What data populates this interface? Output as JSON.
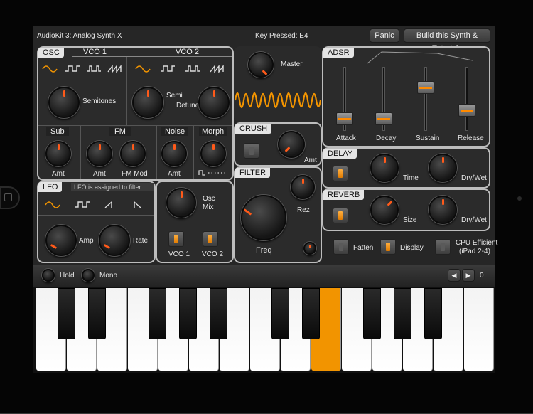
{
  "header": {
    "app_title": "AudioKit 3: Analog Synth X",
    "key_pressed": "Key Pressed: E4",
    "panic_label": "Panic",
    "build_label": "Build this Synth & Tutorials"
  },
  "osc": {
    "tab": "OSC",
    "vco1_title": "VCO 1",
    "vco2_title": "VCO 2",
    "semitones_label": "Semitones",
    "semi_label": "Semi",
    "detune_label": "Detune",
    "sub_title": "Sub",
    "fm_title": "FM",
    "noise_title": "Noise",
    "morph_title": "Morph",
    "sub_amt": "Amt",
    "fm_amt": "Amt",
    "fm_mod": "FM Mod",
    "noise_amt": "Amt"
  },
  "master": {
    "label": "Master"
  },
  "crush": {
    "tab": "CRUSH",
    "amt_label": "Amt"
  },
  "filter": {
    "tab": "FILTER",
    "freq_label": "Freq",
    "rez_label": "Rez"
  },
  "adsr": {
    "tab": "ADSR",
    "attack": "Attack",
    "decay": "Decay",
    "sustain": "Sustain",
    "release": "Release"
  },
  "delay": {
    "tab": "DELAY",
    "time_label": "Time",
    "drywet_label": "Dry/Wet"
  },
  "reverb": {
    "tab": "REVERB",
    "size_label": "Size",
    "drywet_label": "Dry/Wet"
  },
  "options": {
    "fatten": "Fatten",
    "display": "Display",
    "cpu_line1": "CPU Efficient",
    "cpu_line2": "(iPad 2-4)"
  },
  "lfo": {
    "tab": "LFO",
    "note": "LFO is assigned to filter",
    "amp_label": "Amp",
    "rate_label": "Rate"
  },
  "oscmix": {
    "label_line1": "Osc",
    "label_line2": "Mix",
    "vco1": "VCO 1",
    "vco2": "VCO 2"
  },
  "bottom": {
    "hold": "Hold",
    "mono": "Mono",
    "octave_value": "0"
  },
  "colors": {
    "accent": "#f29400",
    "indicator": "#ff5a1a"
  }
}
